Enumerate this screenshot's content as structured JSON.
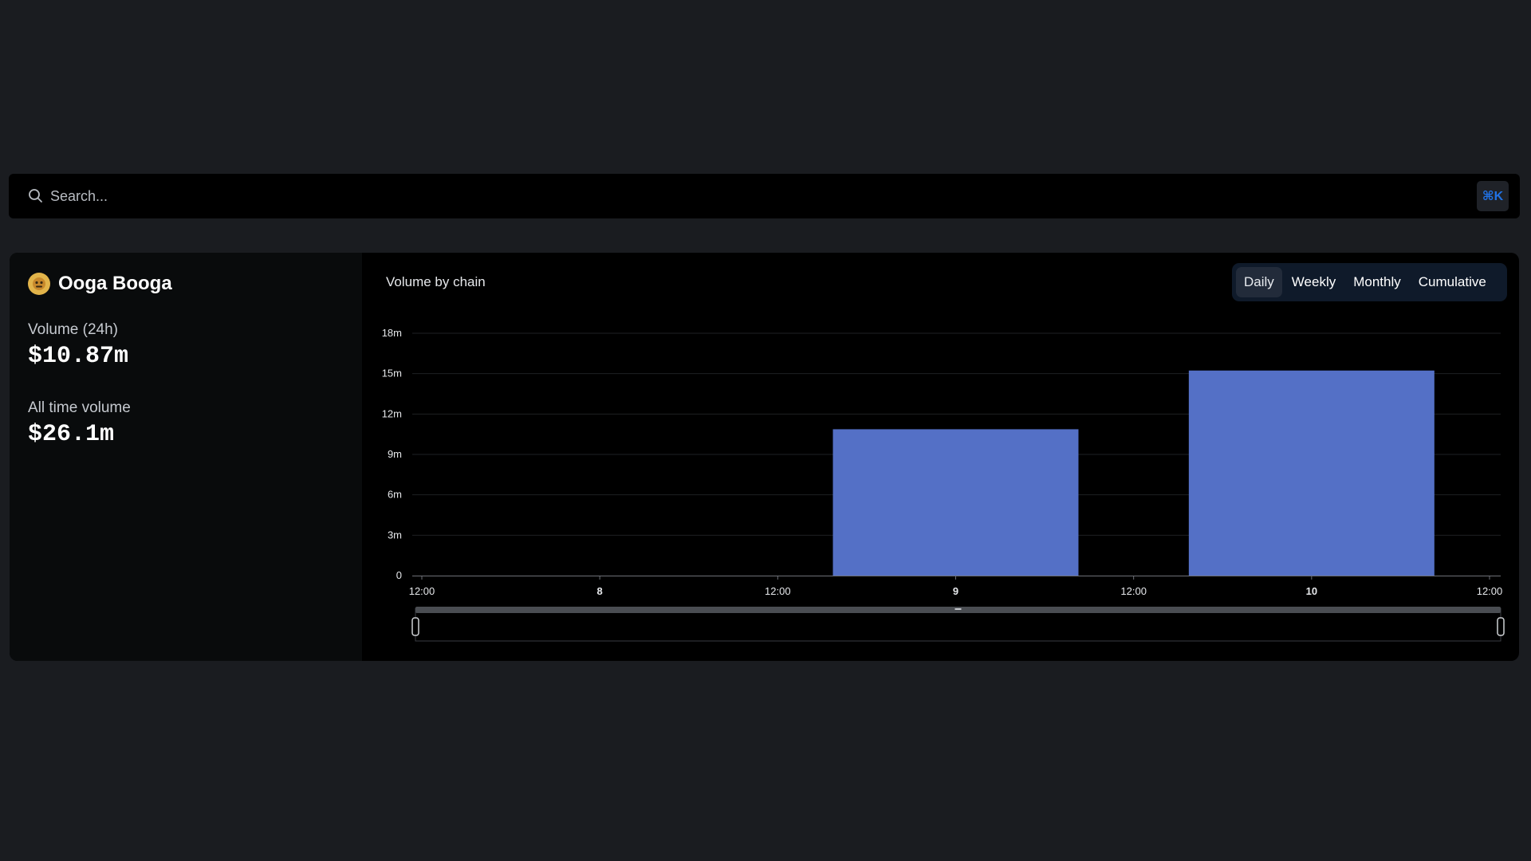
{
  "search": {
    "placeholder": "Search...",
    "shortcut": "⌘K",
    "icon": "search-icon"
  },
  "protocol": {
    "name": "Ooga Booga",
    "logo_icon": "ooga-booga-logo-icon",
    "stats": [
      {
        "label": "Volume (24h)",
        "value": "$10.87m"
      },
      {
        "label": "All time volume",
        "value": "$26.1m"
      }
    ]
  },
  "chart_panel": {
    "title": "Volume by chain",
    "tabs": [
      "Daily",
      "Weekly",
      "Monthly",
      "Cumulative"
    ],
    "active_tab": "Daily"
  },
  "colors": {
    "bar": "#5470c6",
    "page_bg": "#1a1c20",
    "accent": "#2172e5"
  },
  "chart_data": {
    "type": "bar",
    "title": "Volume by chain",
    "xlabel": "",
    "ylabel": "",
    "x_ticks": [
      "12:00",
      "8",
      "12:00",
      "9",
      "12:00",
      "10",
      "12:00"
    ],
    "x_ticks_bold": [
      false,
      true,
      false,
      true,
      false,
      true,
      false
    ],
    "categories": [
      "8",
      "9",
      "10"
    ],
    "values": [
      0,
      10.87,
      15.23
    ],
    "ylim": [
      0,
      18
    ],
    "y_ticks": [
      "0",
      "3m",
      "6m",
      "9m",
      "12m",
      "15m",
      "18m"
    ],
    "grid": true,
    "legend": "none"
  }
}
